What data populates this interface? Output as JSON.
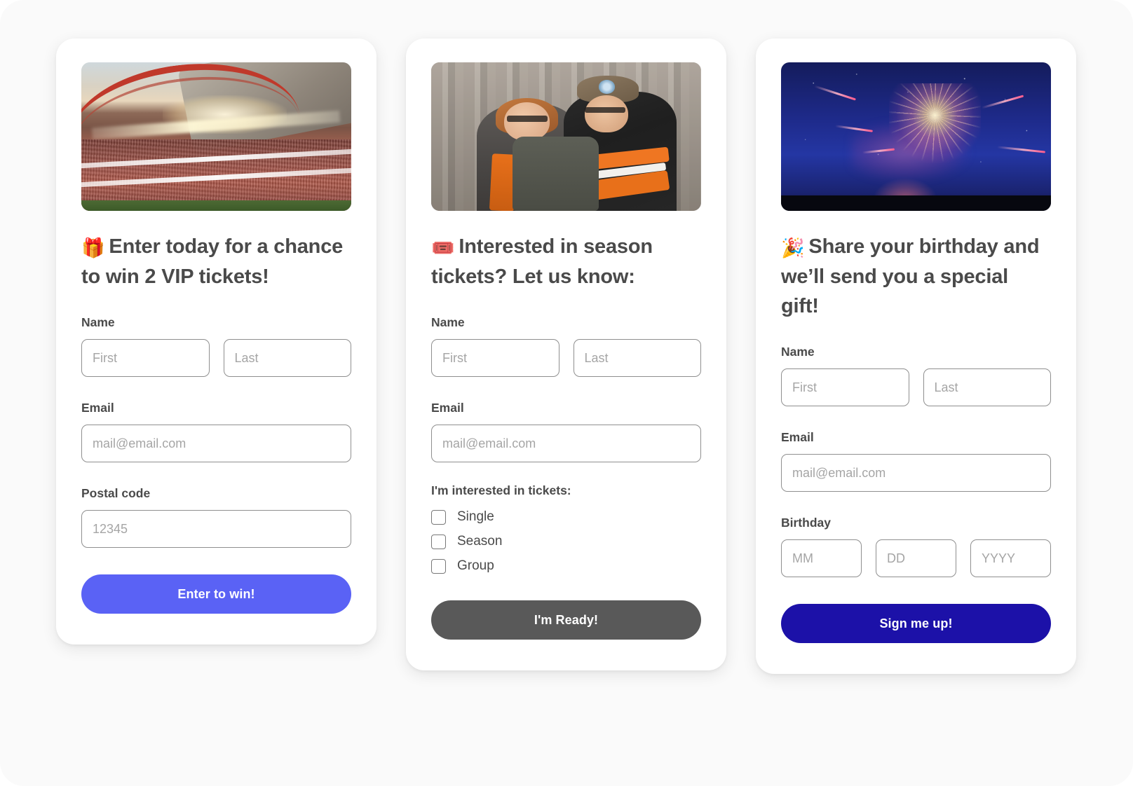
{
  "page": {
    "background": "#fafafa"
  },
  "cards": [
    {
      "id": "vip-giveaway",
      "media": {
        "kind": "stadium-photo",
        "alt": "Packed stadium at sunset with red arch roof"
      },
      "title_emoji": "🎁",
      "title": "Enter today for a chance to win 2 VIP tickets!",
      "fields": {
        "name_label": "Name",
        "first_placeholder": "First",
        "last_placeholder": "Last",
        "email_label": "Email",
        "email_placeholder": "mail@email.com",
        "postal_label": "Postal code",
        "postal_placeholder": "12345"
      },
      "button": {
        "label": "Enter to win!",
        "color": "#5a62f5",
        "text_color": "#ffffff"
      }
    },
    {
      "id": "season-tickets",
      "media": {
        "kind": "fans-photo",
        "alt": "Two smiling hockey fans in orange and black jerseys"
      },
      "title_emoji": "🎟️",
      "title": "Interested in season tickets? Let us know:",
      "fields": {
        "name_label": "Name",
        "first_placeholder": "First",
        "last_placeholder": "Last",
        "email_label": "Email",
        "email_placeholder": "mail@email.com"
      },
      "checkbox_group": {
        "legend": "I'm interested in tickets:",
        "options": [
          {
            "label": "Single",
            "checked": false
          },
          {
            "label": "Season",
            "checked": false
          },
          {
            "label": "Group",
            "checked": false
          }
        ]
      },
      "button": {
        "label": "I'm Ready!",
        "color": "#595959",
        "text_color": "#ffffff"
      }
    },
    {
      "id": "birthday-gift",
      "media": {
        "kind": "fireworks-photo",
        "alt": "Fireworks bursting over a dark treeline in a blue night sky"
      },
      "title_emoji": "🎉",
      "title": "Share your birthday and we’ll send you a special gift!",
      "fields": {
        "name_label": "Name",
        "first_placeholder": "First",
        "last_placeholder": "Last",
        "email_label": "Email",
        "email_placeholder": "mail@email.com",
        "birthday_label": "Birthday",
        "month_placeholder": "MM",
        "day_placeholder": "DD",
        "year_placeholder": "YYYY"
      },
      "button": {
        "label": "Sign me up!",
        "color": "#1c11a8",
        "text_color": "#ffffff"
      }
    }
  ]
}
